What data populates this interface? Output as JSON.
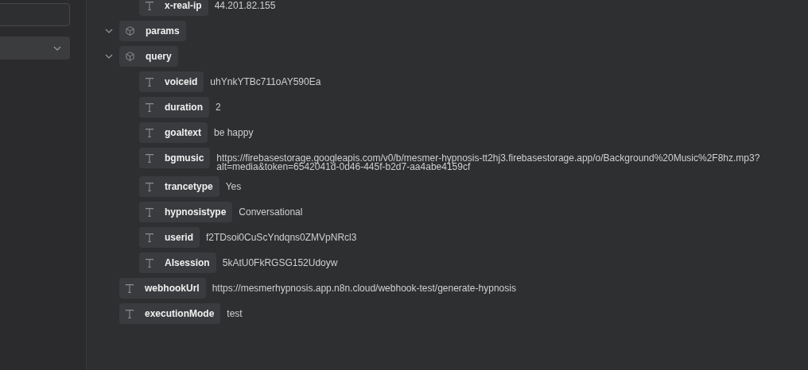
{
  "tree": {
    "continued_children": [
      {
        "kind": "string",
        "key": "x-real-ip",
        "value": "44.201.82.155"
      }
    ],
    "nodes": [
      {
        "kind": "object",
        "key": "params",
        "expanded": true
      },
      {
        "kind": "object",
        "key": "query",
        "expanded": true,
        "children": [
          {
            "kind": "string",
            "key": "voiceid",
            "value": "uhYnkYTBc711oAY590Ea"
          },
          {
            "kind": "string",
            "key": "duration",
            "value": "2"
          },
          {
            "kind": "string",
            "key": "goaltext",
            "value": "be happy"
          },
          {
            "kind": "string",
            "key": "bgmusic",
            "value": "https://firebasestorage.googleapis.com/v0/b/mesmer-hypnosis-tt2hj3.firebasestorage.app/o/Background%20Music%2F8hz.mp3?alt=media&token=6542041d-0d46-445f-b2d7-aa4abe4159cf"
          },
          {
            "kind": "string",
            "key": "trancetype",
            "value": "Yes"
          },
          {
            "kind": "string",
            "key": "hypnosistype",
            "value": "Conversational"
          },
          {
            "kind": "string",
            "key": "userid",
            "value": "f2TDsoi0CuScYndqns0ZMVpNRcl3"
          },
          {
            "kind": "string",
            "key": "AIsession",
            "value": "5kAtU0FkRGSG152Udoyw"
          }
        ]
      },
      {
        "kind": "string",
        "key": "webhookUrl",
        "value": "https://mesmerhypnosis.app.n8n.cloud/webhook-test/generate-hypnosis"
      },
      {
        "kind": "string",
        "key": "executionMode",
        "value": "test"
      }
    ]
  }
}
